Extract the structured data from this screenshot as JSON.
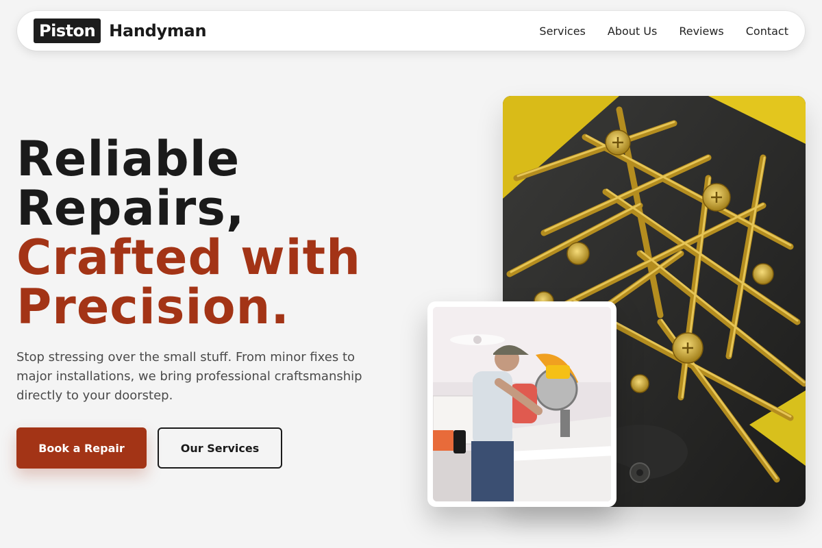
{
  "nav": {
    "brand_box": "Piston",
    "brand_name": "Handyman",
    "links": [
      "Services",
      "About Us",
      "Reviews",
      "Contact"
    ]
  },
  "hero": {
    "headline_line1": "Reliable",
    "headline_line2": "Repairs,",
    "headline_line3": "Crafted with",
    "headline_line4": "Precision.",
    "subtitle": "Stop stressing over the small stuff. From minor fixes to major installations, we bring professional craftsmanship directly to your doorstep.",
    "primary_button": "Book a Repair",
    "secondary_button": "Our Services"
  },
  "colors": {
    "accent": "#a33416",
    "dark": "#1a1a1a",
    "background": "#f4f4f4"
  },
  "images": {
    "main": "screws-in-yellow-bin-photo",
    "inset": "worker-using-miter-saw-photo"
  }
}
